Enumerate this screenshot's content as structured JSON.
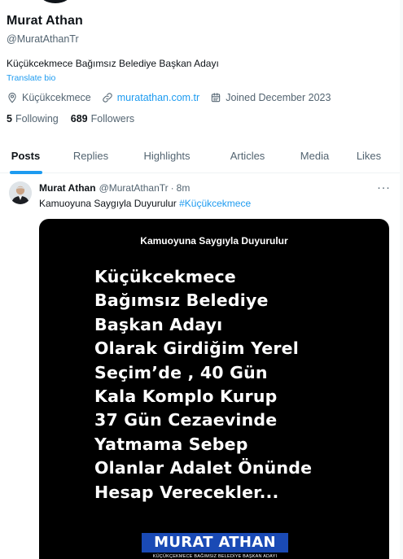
{
  "profile": {
    "name": "Murat Athan",
    "handle": "@MuratAthanTr",
    "bio": "Küçükcekmece Bağımsız Belediye Başkan Adayı",
    "translate_label": "Translate bio",
    "location": "Küçükcekmece",
    "website": "muratathan.com.tr",
    "joined": "Joined December 2023",
    "following_count": "5",
    "following_label": "Following",
    "followers_count": "689",
    "followers_label": "Followers"
  },
  "tabs": [
    {
      "label": "Posts",
      "active": true
    },
    {
      "label": "Replies"
    },
    {
      "label": "Highlights"
    },
    {
      "label": "Articles"
    },
    {
      "label": "Media"
    },
    {
      "label": "Likes"
    }
  ],
  "tweet": {
    "author_name": "Murat Athan",
    "author_handle": "@MuratAthanTr",
    "separator": "·",
    "time": "8m",
    "more_label": "···",
    "text": "Kamuoyuna Saygıyla Duyurulur ",
    "hashtag": "#Küçükcekmece",
    "image": {
      "header": "Kamuoyuna Saygıyla Duyurulur",
      "lines": [
        "Küçükcekmece",
        "Bağımsız Belediye",
        "Başkan Adayı",
        "Olarak Girdiğim Yerel",
        "Seçim’de , 40 Gün",
        "Kala Komplo Kurup",
        "37 Gün Cezaevinde",
        "Yatmama Sebep",
        "Olanlar Adalet Önünde",
        "Hesap Verecekler..."
      ],
      "logo_text": "MURAT ATHAN",
      "logo_subtitle": "KÜÇÜKÇEKMECE BAĞIMSIZ BELEDİYE BAŞKAN ADAYI"
    }
  },
  "colors": {
    "accent": "#1d9bf0",
    "text": "#0f1419",
    "secondary": "#536471",
    "logo_bg": "#1a4ab5"
  }
}
